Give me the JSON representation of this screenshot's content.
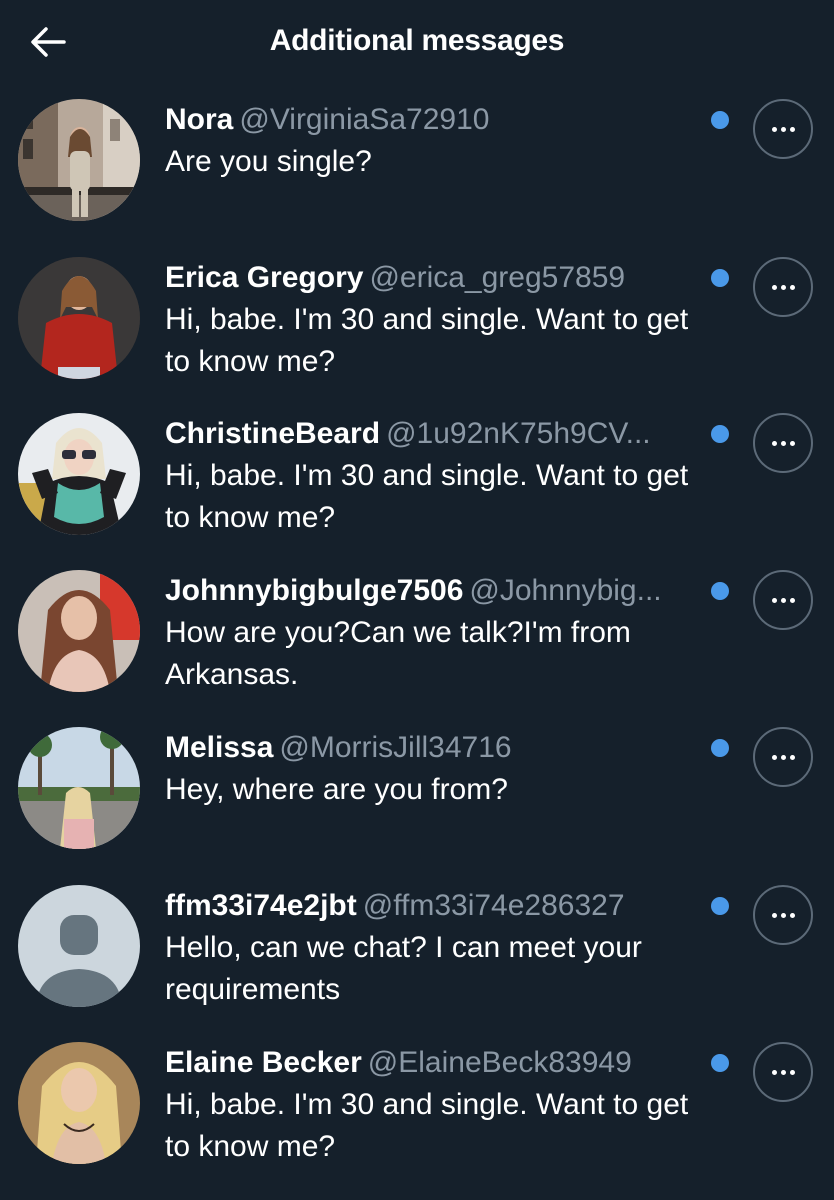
{
  "header": {
    "title": "Additional messages",
    "back_icon": "arrow-left-icon"
  },
  "colors": {
    "background": "#15202b",
    "handle": "#8b98a5",
    "unread_dot": "#4a99e9",
    "more_button_border": "#5c6a78"
  },
  "conversations": [
    {
      "name": "Nora",
      "handle": "@VirginiaSa72910",
      "message": "Are you single?",
      "unread": true,
      "avatar": "profile-photo-woman-balcony"
    },
    {
      "name": "Erica Gregory",
      "handle": "@erica_greg57859",
      "message": "Hi, babe. I'm 30 and single. Want to get to know me?",
      "unread": true,
      "avatar": "profile-photo-woman-red-top"
    },
    {
      "name": "ChristineBeard",
      "handle": "@1u92nK75h9CV...",
      "message": "Hi, babe. I'm 30 and single. Want to get to know me?",
      "unread": true,
      "avatar": "profile-photo-woman-sunglasses-scarf"
    },
    {
      "name": "Johnnybigbulge7506",
      "handle": "@Johnnybig...",
      "message": "How are you?Can we talk?I'm from Arkansas.",
      "unread": true,
      "avatar": "profile-photo-woman-long-hair"
    },
    {
      "name": "Melissa",
      "handle": "@MorrisJill34716",
      "message": "Hey, where are you from?",
      "unread": true,
      "avatar": "profile-photo-woman-palm-street"
    },
    {
      "name": "ffm33i74e2jbt",
      "handle": "@ffm33i74e286327",
      "message": "Hello, can we chat? I can meet your requirements",
      "unread": true,
      "avatar": "default-profile-icon"
    },
    {
      "name": "Elaine Becker",
      "handle": "@ElaineBeck83949",
      "message": "Hi, babe. I'm 30 and single. Want to get to know me?",
      "unread": true,
      "avatar": "profile-photo-woman-blonde"
    }
  ]
}
